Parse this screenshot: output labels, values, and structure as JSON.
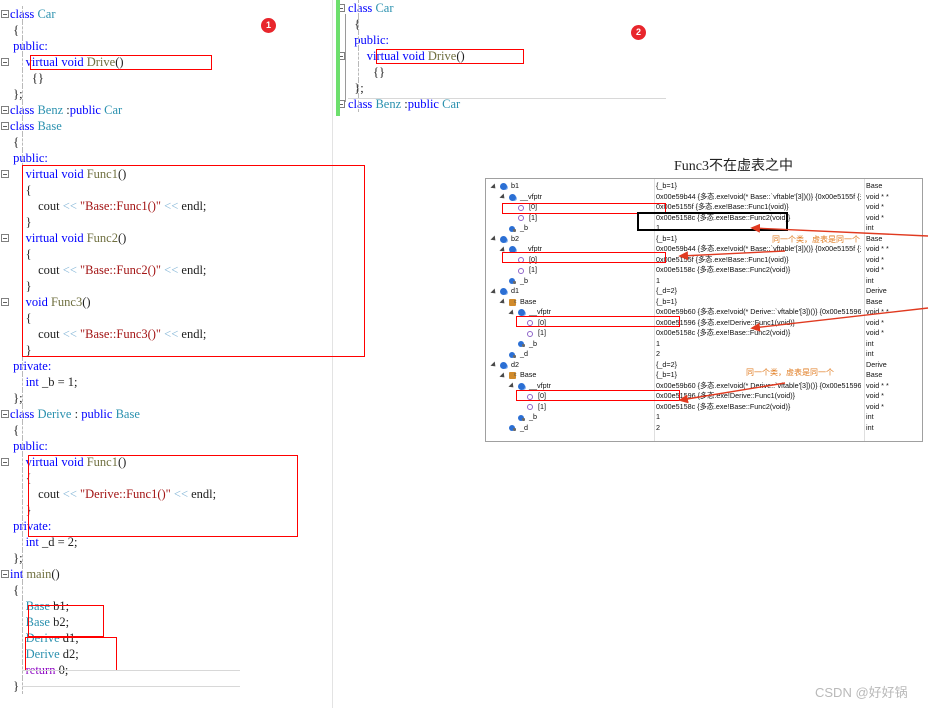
{
  "left_panel": {
    "lines": [
      {
        "g": "minus",
        "indent": 0,
        "tokens": [
          [
            "kw",
            "class "
          ],
          [
            "type",
            "Car"
          ]
        ]
      },
      {
        "g": "",
        "indent": 0,
        "tokens": [
          [
            "plain",
            " {"
          ]
        ]
      },
      {
        "g": "",
        "indent": 0,
        "tokens": [
          [
            "kw",
            " public:"
          ]
        ]
      },
      {
        "g": "minus",
        "indent": 0,
        "tokens": [
          [
            "kw",
            "     virtual void "
          ],
          [
            "fn",
            "Drive"
          ],
          [
            "plain",
            "()"
          ]
        ]
      },
      {
        "g": "",
        "indent": 0,
        "tokens": [
          [
            "plain",
            "       {}"
          ]
        ]
      },
      {
        "g": "",
        "indent": 0,
        "tokens": [
          [
            "plain",
            " };"
          ]
        ]
      },
      {
        "g": "minus",
        "indent": 0,
        "tokens": [
          [
            "kw",
            "class "
          ],
          [
            "type",
            "Benz "
          ],
          [
            "plain",
            ":"
          ],
          [
            "kw",
            "public "
          ],
          [
            "type",
            "Car"
          ]
        ]
      },
      {
        "g": "minus",
        "indent": 0,
        "tokens": [
          [
            "kw",
            "class "
          ],
          [
            "type",
            "Base"
          ]
        ]
      },
      {
        "g": "",
        "indent": 0,
        "tokens": [
          [
            "plain",
            " {"
          ]
        ]
      },
      {
        "g": "",
        "indent": 0,
        "tokens": [
          [
            "kw",
            " public:"
          ]
        ]
      },
      {
        "g": "minus",
        "indent": 0,
        "tokens": [
          [
            "kw",
            "     virtual void "
          ],
          [
            "fn",
            "Func1"
          ],
          [
            "plain",
            "()"
          ]
        ]
      },
      {
        "g": "",
        "indent": 0,
        "tokens": [
          [
            "plain",
            "     {"
          ]
        ]
      },
      {
        "g": "",
        "indent": 0,
        "tokens": [
          [
            "plain",
            "         cout "
          ],
          [
            "op",
            "<< "
          ],
          [
            "str",
            "\"Base::Func1()\""
          ],
          [
            "op",
            " << "
          ],
          [
            "plain",
            "endl;"
          ]
        ]
      },
      {
        "g": "",
        "indent": 0,
        "tokens": [
          [
            "plain",
            "     }"
          ]
        ]
      },
      {
        "g": "minus",
        "indent": 0,
        "tokens": [
          [
            "kw",
            "     virtual void "
          ],
          [
            "fn",
            "Func2"
          ],
          [
            "plain",
            "()"
          ]
        ]
      },
      {
        "g": "",
        "indent": 0,
        "tokens": [
          [
            "plain",
            "     {"
          ]
        ]
      },
      {
        "g": "",
        "indent": 0,
        "tokens": [
          [
            "plain",
            "         cout "
          ],
          [
            "op",
            "<< "
          ],
          [
            "str",
            "\"Base::Func2()\""
          ],
          [
            "op",
            " << "
          ],
          [
            "plain",
            "endl;"
          ]
        ]
      },
      {
        "g": "",
        "indent": 0,
        "tokens": [
          [
            "plain",
            "     }"
          ]
        ]
      },
      {
        "g": "minus",
        "indent": 0,
        "tokens": [
          [
            "kw",
            "     void "
          ],
          [
            "fn",
            "Func3"
          ],
          [
            "plain",
            "()"
          ]
        ]
      },
      {
        "g": "",
        "indent": 0,
        "tokens": [
          [
            "plain",
            "     {"
          ]
        ]
      },
      {
        "g": "",
        "indent": 0,
        "tokens": [
          [
            "plain",
            "         cout "
          ],
          [
            "op",
            "<< "
          ],
          [
            "str",
            "\"Base::Func3()\""
          ],
          [
            "op",
            " << "
          ],
          [
            "plain",
            "endl;"
          ]
        ]
      },
      {
        "g": "",
        "indent": 0,
        "tokens": [
          [
            "plain",
            "     }"
          ]
        ]
      },
      {
        "g": "",
        "indent": 0,
        "tokens": [
          [
            "kw",
            " private:"
          ]
        ]
      },
      {
        "g": "",
        "indent": 0,
        "tokens": [
          [
            "kw",
            "     int "
          ],
          [
            "plain",
            "_b = 1;"
          ]
        ]
      },
      {
        "g": "",
        "indent": 0,
        "tokens": [
          [
            "plain",
            " };"
          ]
        ]
      },
      {
        "g": "minus",
        "indent": 0,
        "tokens": [
          [
            "kw",
            "class "
          ],
          [
            "type",
            "Derive "
          ],
          [
            "plain",
            ": "
          ],
          [
            "kw",
            "public "
          ],
          [
            "type",
            "Base"
          ]
        ]
      },
      {
        "g": "",
        "indent": 0,
        "tokens": [
          [
            "plain",
            " {"
          ]
        ]
      },
      {
        "g": "",
        "indent": 0,
        "tokens": [
          [
            "kw",
            " public:"
          ]
        ]
      },
      {
        "g": "minus",
        "indent": 0,
        "tokens": [
          [
            "kw",
            "     virtual void "
          ],
          [
            "fn",
            "Func1"
          ],
          [
            "plain",
            "()"
          ]
        ]
      },
      {
        "g": "",
        "indent": 0,
        "tokens": [
          [
            "plain",
            "     {"
          ]
        ]
      },
      {
        "g": "",
        "indent": 0,
        "tokens": [
          [
            "plain",
            "         cout "
          ],
          [
            "op",
            "<< "
          ],
          [
            "str",
            "\"Derive::Func1()\""
          ],
          [
            "op",
            " << "
          ],
          [
            "plain",
            "endl;"
          ]
        ]
      },
      {
        "g": "",
        "indent": 0,
        "tokens": [
          [
            "plain",
            "     }"
          ]
        ]
      },
      {
        "g": "",
        "indent": 0,
        "tokens": [
          [
            "kw",
            " private:"
          ]
        ]
      },
      {
        "g": "",
        "indent": 0,
        "tokens": [
          [
            "kw",
            "     int "
          ],
          [
            "plain",
            "_d = 2;"
          ]
        ]
      },
      {
        "g": "",
        "indent": 0,
        "tokens": [
          [
            "plain",
            " };"
          ]
        ]
      },
      {
        "g": "minus",
        "indent": 0,
        "tokens": [
          [
            "kw",
            "int "
          ],
          [
            "fn",
            "main"
          ],
          [
            "plain",
            "()"
          ]
        ]
      },
      {
        "g": "",
        "indent": 0,
        "tokens": [
          [
            "plain",
            " {"
          ]
        ]
      },
      {
        "g": "",
        "indent": 0,
        "tokens": [
          [
            "type",
            "     Base "
          ],
          [
            "plain",
            "b1;"
          ]
        ]
      },
      {
        "g": "",
        "indent": 0,
        "tokens": [
          [
            "type",
            "     Base "
          ],
          [
            "plain",
            "b2;"
          ]
        ]
      },
      {
        "g": "",
        "indent": 0,
        "tokens": [
          [
            "type",
            "     Derive "
          ],
          [
            "plain",
            "d1;"
          ]
        ]
      },
      {
        "g": "",
        "indent": 0,
        "tokens": [
          [
            "type",
            "     Derive "
          ],
          [
            "plain",
            "d2;"
          ]
        ]
      },
      {
        "g": "",
        "indent": 0,
        "tokens": [
          [
            "ctrl",
            "     return "
          ],
          [
            "plain",
            "0;"
          ]
        ]
      },
      {
        "g": "",
        "indent": 0,
        "tokens": [
          [
            "plain",
            " }"
          ]
        ]
      }
    ]
  },
  "right_panel": {
    "lines": [
      {
        "g": "minus",
        "tokens": [
          [
            "kw",
            "class "
          ],
          [
            "type",
            "Car"
          ]
        ]
      },
      {
        "g": "",
        "tokens": [
          [
            "plain",
            "  {"
          ]
        ]
      },
      {
        "g": "",
        "tokens": [
          [
            "kw",
            "  public:"
          ]
        ]
      },
      {
        "g": "minus",
        "tokens": [
          [
            "kw",
            "      virtual void "
          ],
          [
            "fn",
            "Drive"
          ],
          [
            "plain",
            "()"
          ]
        ]
      },
      {
        "g": "",
        "tokens": [
          [
            "plain",
            "        {}"
          ]
        ]
      },
      {
        "g": "",
        "tokens": [
          [
            "plain",
            "  };"
          ]
        ]
      },
      {
        "g": "minus",
        "tokens": [
          [
            "kw",
            "class "
          ],
          [
            "type",
            "Benz "
          ],
          [
            "plain",
            ":"
          ],
          [
            "kw",
            "public "
          ],
          [
            "type",
            "Car"
          ]
        ]
      }
    ]
  },
  "badges": [
    {
      "label": "1"
    },
    {
      "label": "2"
    }
  ],
  "heading": "Func3不在虚表之中",
  "annotations": [
    {
      "text": "同一个类，虚表是同一个"
    },
    {
      "text": "同一个类，虚表是同一个"
    }
  ],
  "watermark": "CSDN @好好锅",
  "watch": {
    "rows": [
      {
        "depth": 0,
        "expander": true,
        "icon": "object",
        "name": "b1",
        "value": "{_b=1}",
        "type": "Base"
      },
      {
        "depth": 1,
        "expander": true,
        "icon": "object",
        "name": "__vfptr",
        "value": "0x00e59b44 {多态.exe!void(* Base::`vftable'[3])()} {0x00e5155f {多...",
        "type": "void * *"
      },
      {
        "depth": 2,
        "expander": false,
        "icon": "pointer",
        "name": "[0]",
        "value": "0x00e5155f {多态.exe!Base::Func1(void)}",
        "type": "void *"
      },
      {
        "depth": 2,
        "expander": false,
        "icon": "pointer",
        "name": "[1]",
        "value": "0x00e5158c {多态.exe!Base::Func2(void)}",
        "type": "void *"
      },
      {
        "depth": 1,
        "expander": false,
        "icon": "field",
        "name": "_b",
        "value": "1",
        "type": "int"
      },
      {
        "depth": 0,
        "expander": true,
        "icon": "object",
        "name": "b2",
        "value": "{_b=1}",
        "type": "Base"
      },
      {
        "depth": 1,
        "expander": true,
        "icon": "object",
        "name": "__vfptr",
        "value": "0x00e59b44 {多态.exe!void(* Base::`vftable'[3])()} {0x00e5155f {多...",
        "type": "void * *"
      },
      {
        "depth": 2,
        "expander": false,
        "icon": "pointer",
        "name": "[0]",
        "value": "0x00e5155f {多态.exe!Base::Func1(void)}",
        "type": "void *"
      },
      {
        "depth": 2,
        "expander": false,
        "icon": "pointer",
        "name": "[1]",
        "value": "0x00e5158c {多态.exe!Base::Func2(void)}",
        "type": "void *"
      },
      {
        "depth": 1,
        "expander": false,
        "icon": "field",
        "name": "_b",
        "value": "1",
        "type": "int"
      },
      {
        "depth": 0,
        "expander": true,
        "icon": "object",
        "name": "d1",
        "value": "{_d=2}",
        "type": "Derive"
      },
      {
        "depth": 1,
        "expander": true,
        "icon": "baseclass",
        "name": "Base",
        "value": "{_b=1}",
        "type": "Base"
      },
      {
        "depth": 2,
        "expander": true,
        "icon": "object",
        "name": "__vfptr",
        "value": "0x00e59b60 {多态.exe!void(* Derive::`vftable'[3])()} {0x00e51596 {...",
        "type": "void * *"
      },
      {
        "depth": 3,
        "expander": false,
        "icon": "pointer",
        "name": "[0]",
        "value": "0x00e51596 {多态.exe!Derive::Func1(void)}",
        "type": "void *"
      },
      {
        "depth": 3,
        "expander": false,
        "icon": "pointer",
        "name": "[1]",
        "value": "0x00e5158c {多态.exe!Base::Func2(void)}",
        "type": "void *"
      },
      {
        "depth": 2,
        "expander": false,
        "icon": "field",
        "name": "_b",
        "value": "1",
        "type": "int"
      },
      {
        "depth": 1,
        "expander": false,
        "icon": "field",
        "name": "_d",
        "value": "2",
        "type": "int"
      },
      {
        "depth": 0,
        "expander": true,
        "icon": "object",
        "name": "d2",
        "value": "{_d=2}",
        "type": "Derive"
      },
      {
        "depth": 1,
        "expander": true,
        "icon": "baseclass",
        "name": "Base",
        "value": "{_b=1}",
        "type": "Base"
      },
      {
        "depth": 2,
        "expander": true,
        "icon": "object",
        "name": "__vfptr",
        "value": "0x00e59b60 {多态.exe!void(* Derive::`vftable'[3])()} {0x00e51596 {...",
        "type": "void * *"
      },
      {
        "depth": 3,
        "expander": false,
        "icon": "pointer",
        "name": "[0]",
        "value": "0x00e51596 {多态.exe!Derive::Func1(void)}",
        "type": "void *"
      },
      {
        "depth": 3,
        "expander": false,
        "icon": "pointer",
        "name": "[1]",
        "value": "0x00e5158c {多态.exe!Base::Func2(void)}",
        "type": "void *"
      },
      {
        "depth": 2,
        "expander": false,
        "icon": "field",
        "name": "_b",
        "value": "1",
        "type": "int"
      },
      {
        "depth": 1,
        "expander": false,
        "icon": "field",
        "name": "_d",
        "value": "2",
        "type": "int"
      }
    ]
  },
  "colors": {
    "highlight_red": "#ff0000",
    "highlight_black": "#000000",
    "badge_red": "#e8262c",
    "annotation_orange": "#e07b20",
    "change_bar_green": "#6ddf6d",
    "keyword_blue": "#0000ff",
    "type_teal": "#2b91af",
    "string_red": "#a31515"
  }
}
